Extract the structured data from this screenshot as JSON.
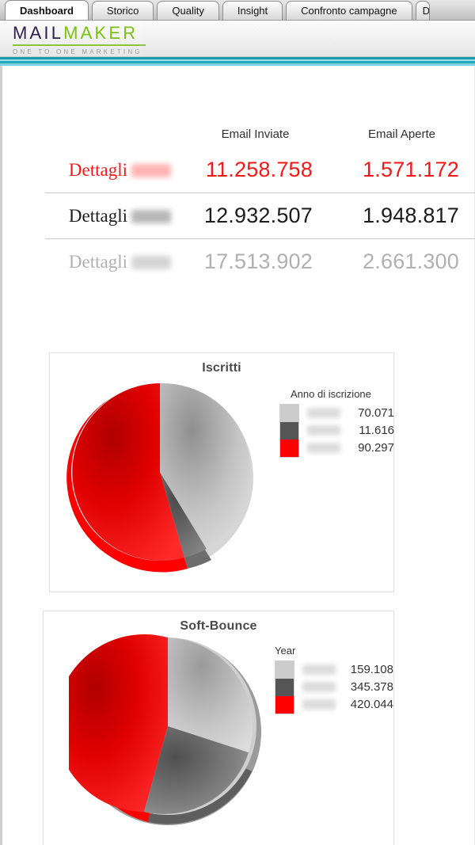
{
  "window": {
    "tabs": [
      {
        "label": "Dashboard",
        "active": true
      },
      {
        "label": "Storico",
        "active": false
      },
      {
        "label": "Quality",
        "active": false
      },
      {
        "label": "Insight",
        "active": false
      },
      {
        "label": "Confronto campagne",
        "active": false
      },
      {
        "label": "D",
        "active": false,
        "truncated": true
      }
    ]
  },
  "branding": {
    "logo_primary": "MAIL",
    "logo_secondary": "MAKER",
    "tagline": "ONE TO ONE MARKETING",
    "color_primary": "#2b2050",
    "color_secondary": "#7ac20f",
    "accent_bar": "#1fa9ba"
  },
  "summary": {
    "columns": [
      "",
      "Email Inviate",
      "Email Aperte"
    ],
    "rows": [
      {
        "link": "Dettagli",
        "year": "",
        "emails_sent": "11.258.758",
        "emails_opened": "1.571.172",
        "style": "r-red"
      },
      {
        "link": "Dettagli",
        "year": "",
        "emails_sent": "12.932.507",
        "emails_opened": "1.948.817",
        "style": "r-black"
      },
      {
        "link": "Dettagli",
        "year": "",
        "emails_sent": "17.513.902",
        "emails_opened": "2.661.300",
        "style": "r-gray"
      }
    ]
  },
  "charts": [
    {
      "title": "Iscritti",
      "legend_title": "Anno di iscrizione",
      "values": [
        "70.071",
        "11.616",
        "90.297"
      ]
    },
    {
      "title": "Soft-Bounce",
      "legend_title": "Year",
      "values": [
        "159.108",
        "345.378",
        "420.044"
      ]
    }
  ],
  "chart_data": [
    {
      "type": "pie",
      "title": "Iscritti",
      "legend_title": "Anno di iscrizione",
      "legend_position": "right",
      "categories": [
        "",
        "",
        ""
      ],
      "values": [
        70071,
        11616,
        90297
      ],
      "value_labels": [
        "70.071",
        "11.616",
        "90.297"
      ],
      "colors": [
        "#cccccc",
        "#555555",
        "#ff0000"
      ],
      "percentages": [
        40.7,
        6.8,
        52.5
      ],
      "total": 171984
    },
    {
      "type": "pie",
      "title": "Soft-Bounce",
      "legend_title": "Year",
      "legend_position": "right",
      "categories": [
        "",
        "",
        ""
      ],
      "values": [
        159108,
        345378,
        420044
      ],
      "value_labels": [
        "159.108",
        "345.378",
        "420.044"
      ],
      "colors": [
        "#cccccc",
        "#555555",
        "#ff0000"
      ],
      "percentages": [
        17.2,
        37.4,
        45.4
      ],
      "total": 924530
    }
  ]
}
